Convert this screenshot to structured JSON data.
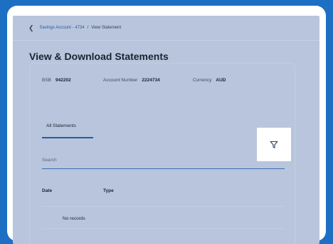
{
  "breadcrumb": {
    "back_icon": "chevron-left-icon",
    "account_link": "Savings Account - 4734",
    "separator": "/",
    "current": "View Statement"
  },
  "page": {
    "title": "View & Download Statements"
  },
  "account_info": {
    "bsb_label": "BSB",
    "bsb_value": "942202",
    "account_number_label": "Account Number",
    "account_number_value": "2224734",
    "currency_label": "Currency",
    "currency_value": "AUD"
  },
  "tabs": [
    {
      "label": "All Statements",
      "active": true
    }
  ],
  "search": {
    "placeholder": "Search",
    "filter_icon": "filter-icon"
  },
  "table": {
    "columns": [
      "Date",
      "Type"
    ],
    "empty_text": "No records"
  },
  "colors": {
    "accent": "#2c5aa0",
    "background": "#1d6fc4",
    "overlay": "#b8c5dc"
  }
}
